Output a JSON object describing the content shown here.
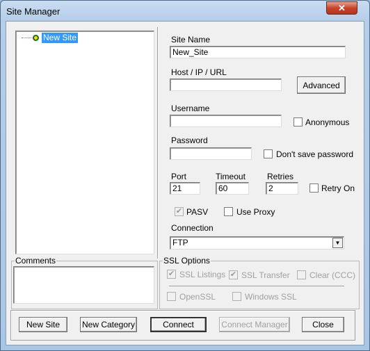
{
  "window": {
    "title": "Site Manager",
    "close_icon": "close-icon"
  },
  "tree": {
    "items": [
      {
        "label": "New Site",
        "selected": true
      }
    ]
  },
  "form": {
    "site_name": {
      "label": "Site Name",
      "value": "New_Site"
    },
    "host": {
      "label": "Host / IP / URL",
      "value": ""
    },
    "advanced_label": "Advanced",
    "username": {
      "label": "Username",
      "value": ""
    },
    "anonymous": {
      "label": "Anonymous",
      "checked": false
    },
    "password": {
      "label": "Password",
      "value": ""
    },
    "dont_save": {
      "label": "Don't save password",
      "checked": false
    },
    "port": {
      "label": "Port",
      "value": "21"
    },
    "timeout": {
      "label": "Timeout",
      "value": "60"
    },
    "retries": {
      "label": "Retries",
      "value": "2"
    },
    "retry_on": {
      "label": "Retry On",
      "checked": false
    },
    "pasv": {
      "label": "PASV",
      "checked": true
    },
    "use_proxy": {
      "label": "Use Proxy",
      "checked": false
    },
    "connection": {
      "label": "Connection",
      "value": "FTP"
    }
  },
  "comments": {
    "label": "Comments",
    "value": ""
  },
  "ssl": {
    "label": "SSL Options",
    "ssl_listings": {
      "label": "SSL Listings",
      "checked": true
    },
    "ssl_transfer": {
      "label": "SSL Transfer",
      "checked": true
    },
    "clear_ccc": {
      "label": "Clear (CCC)",
      "checked": false
    },
    "openssl": {
      "label": "OpenSSL",
      "checked": false
    },
    "windows_ssl": {
      "label": "Windows SSL",
      "checked": false
    }
  },
  "buttons": {
    "new_site": "New Site",
    "new_category": "New Category",
    "connect": "Connect",
    "connect_manager": "Connect Manager",
    "close": "Close"
  }
}
